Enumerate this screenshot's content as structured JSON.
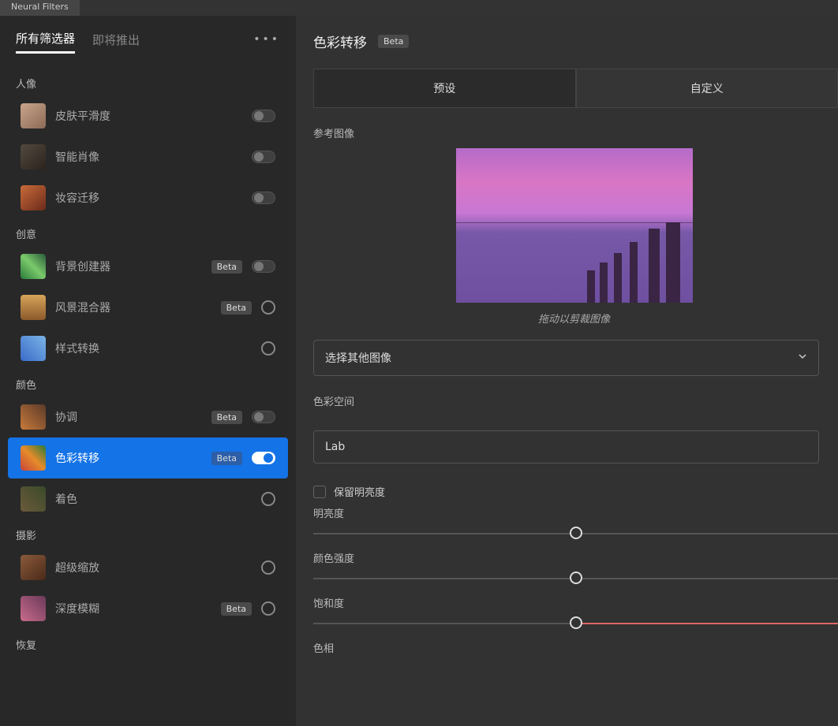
{
  "tabbar": {
    "title": "Neural Filters"
  },
  "sidebar": {
    "tabs": {
      "all": "所有筛选器",
      "coming": "即将推出"
    },
    "categories": {
      "portrait": "人像",
      "creative": "创意",
      "color": "颜色",
      "photo": "摄影",
      "restore": "恢复"
    },
    "filters": {
      "skin": {
        "label": "皮肤平滑度"
      },
      "smart": {
        "label": "智能肖像"
      },
      "makeup": {
        "label": "妆容迁移"
      },
      "bg": {
        "label": "背景创建器",
        "beta": "Beta"
      },
      "landscape": {
        "label": "风景混合器",
        "beta": "Beta"
      },
      "style": {
        "label": "样式转换"
      },
      "harmonize": {
        "label": "协调",
        "beta": "Beta"
      },
      "colortx": {
        "label": "色彩转移",
        "beta": "Beta"
      },
      "colorize": {
        "label": "着色"
      },
      "zoom": {
        "label": "超级缩放"
      },
      "blur": {
        "label": "深度模糊",
        "beta": "Beta"
      }
    }
  },
  "main": {
    "title": "色彩转移",
    "beta": "Beta",
    "tabs": {
      "preset": "预设",
      "custom": "自定义"
    },
    "ref": {
      "label": "参考图像",
      "caption": "拖动以剪裁图像"
    },
    "selectOther": "选择其他图像",
    "colorspace": {
      "label": "色彩空间",
      "value": "Lab"
    },
    "preserveLum": "保留明亮度",
    "sliders": {
      "luminance": "明亮度",
      "intensity": "颜色强度",
      "saturation": "饱和度",
      "hue": "色相"
    }
  }
}
